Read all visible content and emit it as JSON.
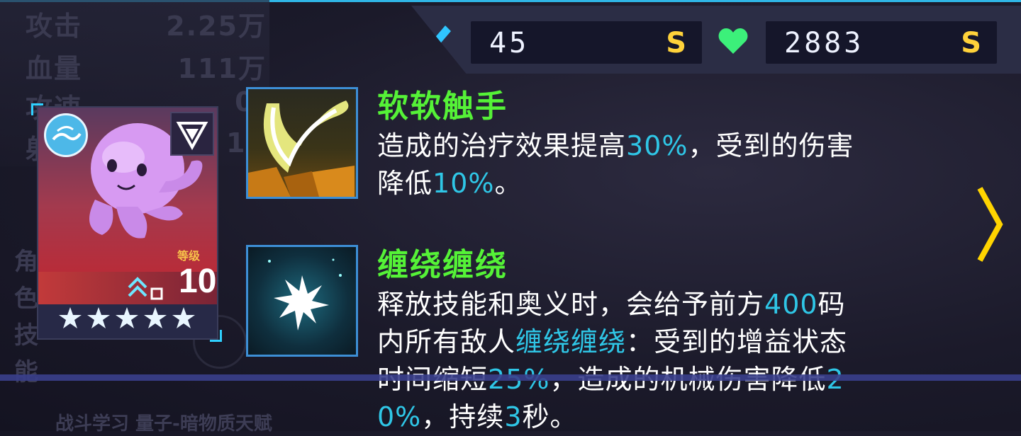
{
  "background": {
    "stats": [
      {
        "label": "攻击",
        "value": "2.25万"
      },
      {
        "label": "血量",
        "value": "111万"
      },
      {
        "label": "攻速",
        "value": "0."
      },
      {
        "label": "射",
        "value": "11"
      }
    ],
    "side_chars": [
      "角",
      "色",
      "技",
      "能"
    ],
    "bottom_text": "战斗学习 量子-暗物质天赋"
  },
  "resources": [
    {
      "icon": "rocket-icon",
      "value": "45",
      "unit": "S",
      "color": "#2fc6ff"
    },
    {
      "icon": "heart-icon",
      "value": "2883",
      "unit": "S",
      "color": "#3cf07a"
    }
  ],
  "hero_card": {
    "level_label": "等级",
    "level": "10",
    "stars": 5,
    "element_icon": "water-wave-icon",
    "role_icon": "triangle-emblem-icon",
    "colors": {
      "top": "#a33a4e",
      "accent": "#2fd0ff"
    }
  },
  "skills": [
    {
      "name": "软软触手",
      "icon": "tentacle-slash-icon",
      "desc_lines": [
        [
          {
            "t": "造成的治疗效果提高"
          },
          {
            "t": "30%",
            "hl": true
          },
          {
            "t": "，受到的伤害"
          }
        ],
        [
          {
            "t": "降低"
          },
          {
            "t": "10%",
            "hl": true
          },
          {
            "t": "。"
          }
        ]
      ]
    },
    {
      "name": "缠绕缠绕",
      "icon": "leaf-moon-icon",
      "desc_lines": [
        [
          {
            "t": "释放技能和奥义时，会给予前方"
          },
          {
            "t": "400",
            "hl": true
          },
          {
            "t": "码"
          }
        ],
        [
          {
            "t": "内所有敌人"
          },
          {
            "t": "缠绕缠绕",
            "hl": true
          },
          {
            "t": "：受到的增益状态"
          }
        ],
        [
          {
            "t": "时间缩短"
          },
          {
            "t": "25%",
            "hl": true
          },
          {
            "t": "，造成的机械伤害降低"
          },
          {
            "t": "2",
            "hl": true
          }
        ],
        [
          {
            "t": "0%",
            "hl": true
          },
          {
            "t": "，持续"
          },
          {
            "t": "3",
            "hl": true
          },
          {
            "t": "秒。"
          }
        ]
      ]
    }
  ],
  "colors": {
    "skill_name": "#55f237",
    "highlight": "#2fc6e6",
    "currency": "#ffd23a",
    "arrow": "#ffd400"
  }
}
